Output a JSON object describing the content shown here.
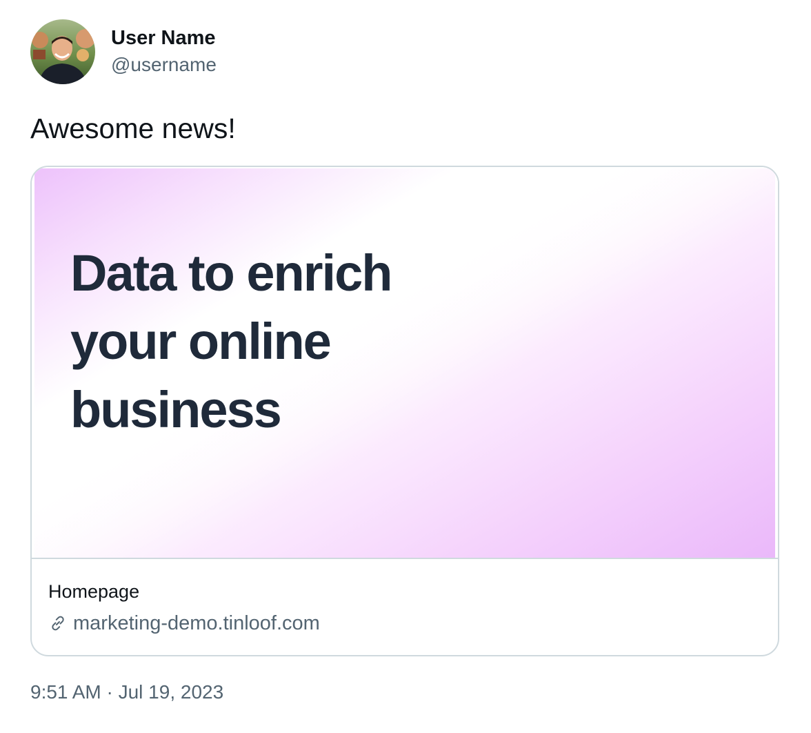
{
  "author": {
    "display_name": "User Name",
    "handle": "@username",
    "avatar_icon": "profile-photo"
  },
  "tweet": {
    "text": "Awesome news!"
  },
  "card": {
    "headline": "Data to enrich your online business",
    "title": "Homepage",
    "domain": "marketing-demo.tinloof.com",
    "link_icon": "link-icon",
    "gradient_colors": [
      "#edc2fb",
      "#ffffff",
      "#eab8fa"
    ]
  },
  "meta": {
    "timestamp": "9:51 AM · Jul 19, 2023"
  },
  "colors": {
    "text_primary": "#0f1419",
    "text_secondary": "#536471",
    "border": "#cfd9de",
    "headline": "#1f2a3a"
  }
}
